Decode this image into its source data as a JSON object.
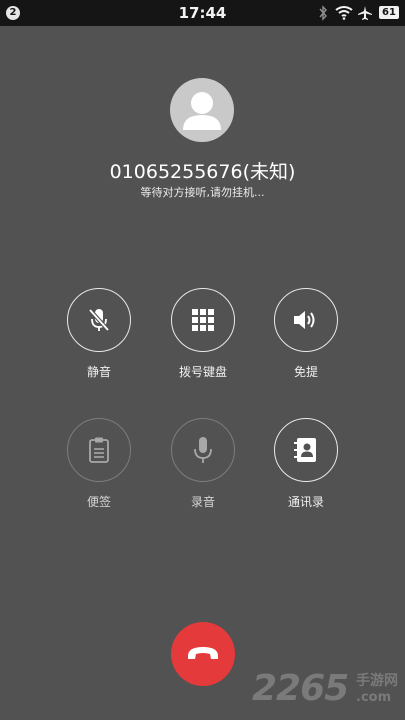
{
  "status_bar": {
    "notification_count": "2",
    "time": "17:44",
    "battery": "61",
    "icons": [
      "bluetooth-icon",
      "wifi-icon",
      "airplane-mode-icon"
    ]
  },
  "caller": {
    "number": "01065255676(未知)",
    "status": "等待对方接听,请勿挂机..."
  },
  "controls": {
    "mute": {
      "label": "静音",
      "icon": "mic-off-icon"
    },
    "keypad": {
      "label": "拨号键盘",
      "icon": "dialpad-icon"
    },
    "speaker": {
      "label": "免提",
      "icon": "speaker-icon"
    },
    "notes": {
      "label": "便签",
      "icon": "clipboard-icon"
    },
    "record": {
      "label": "录音",
      "icon": "microphone-icon"
    },
    "contacts": {
      "label": "通讯录",
      "icon": "contacts-book-icon"
    }
  },
  "hangup": {
    "icon": "hang-up-icon",
    "color": "#e43a3c"
  },
  "watermark": {
    "main": "2265",
    "cn": "手游网",
    "com": ".com"
  }
}
